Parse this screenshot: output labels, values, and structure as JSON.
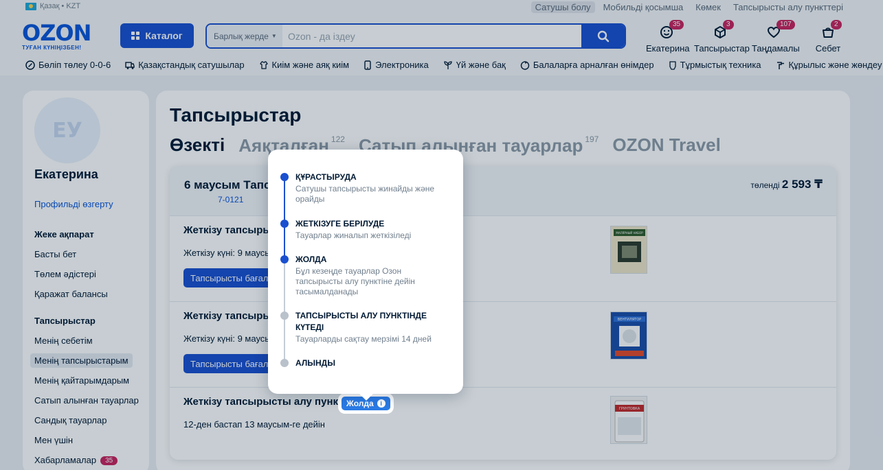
{
  "topbar": {
    "locale": "Қазақ • KZT",
    "links": [
      "Сатушы болу",
      "Мобильді қосымша",
      "Көмек",
      "Тапсырысты алу пункттері"
    ]
  },
  "header": {
    "logo_word": "OZON",
    "logo_sub": "ТУҒАН КҮНІҢІЗБЕН!",
    "catalog_label": "Каталог",
    "search_scope": "Барлық жерде",
    "search_placeholder": "Ozon - да іздеу",
    "items": [
      {
        "label": "Екатерина",
        "badge": "35",
        "icon": "smile-icon"
      },
      {
        "label": "Тапсырыстар",
        "badge": "3",
        "icon": "box-icon"
      },
      {
        "label": "Таңдамалы",
        "badge": "107",
        "icon": "heart-icon"
      },
      {
        "label": "Себет",
        "badge": "2",
        "icon": "cart-icon"
      }
    ]
  },
  "nav": [
    {
      "label": "Бөліп төлеу 0-0-6",
      "icon": "percent-icon"
    },
    {
      "label": "Қазақстандық сатушылар",
      "icon": "truck-icon"
    },
    {
      "label": "Киім және аяқ киім",
      "icon": "shirt-icon"
    },
    {
      "label": "Электроника",
      "icon": "phone-icon"
    },
    {
      "label": "Үй және бақ",
      "icon": "plant-icon"
    },
    {
      "label": "Балаларға арналған өнімдер",
      "icon": "baby-icon"
    },
    {
      "label": "Тұрмыстық техника",
      "icon": "appliance-icon"
    },
    {
      "label": "Құрылыс және жөндеу",
      "icon": "tools-icon"
    }
  ],
  "sidebar": {
    "avatar_initials": "ЕУ",
    "name": "Екатерина",
    "edit_profile": "Профильді өзгерту",
    "section_personal": "Жеке ақпарат",
    "personal_links": [
      "Басты бет",
      "Төлем әдістері",
      "Қаражат балансы"
    ],
    "section_orders": "Тапсырыстар",
    "order_links": [
      "Менің себетім",
      "Менің тапсырыстарым",
      "Менің қайтарымдарым",
      "Сатып алынған тауарлар",
      "Сандық тауарлар",
      "Мен үшін",
      "Хабарламалар"
    ],
    "notifications_badge": "35"
  },
  "main": {
    "title": "Тапсырыстар",
    "tabs": [
      {
        "label": "Өзекті",
        "count": ""
      },
      {
        "label": "Аяқталған",
        "count": "122"
      },
      {
        "label": "Сатып алынған тауарлар",
        "count": "197"
      },
      {
        "label": "OZON Travel",
        "count": ""
      }
    ],
    "order": {
      "date": "6 маусым Тапс",
      "number": "7-0121",
      "paid_label": "төленді",
      "paid_amount": "2 593 ₸",
      "shipments": [
        {
          "title": "Жеткізу тапсырыст",
          "date": "Жеткізу күні: 9 маусым",
          "button": "Тапсырысты бағалау"
        },
        {
          "title": "Жеткізу тапсырыст",
          "date": "Жеткізу күні: 9 маусым",
          "button": "Тапсырысты бағалау"
        },
        {
          "title": "Жеткізу тапсырысты алу пунктіне",
          "date": "12-ден бастап 13 маусым-ге дейін",
          "status": "Жолда"
        }
      ]
    }
  },
  "tooltip": {
    "steps": [
      {
        "title": "ҚҰРАСТЫРУДА",
        "desc": "Сатушы тапсырысты жинайды және орайды",
        "done": true
      },
      {
        "title": "ЖЕТКІЗУГЕ БЕРІЛУДЕ",
        "desc": "Тауарлар жиналып жеткізіледі",
        "done": true
      },
      {
        "title": "ЖОЛДА",
        "desc": "Бұл кезеңде тауарлар Озон тапсырысты алу пунктіне дейін тасымалданады",
        "done": true
      },
      {
        "title": "ТАПСЫРЫСТЫ АЛУ ПУНКТІНДЕ КҮТЕДІ",
        "desc": "Тауарларды сақтау мерзімі 14 дней",
        "done": false
      },
      {
        "title": "АЛЫНДЫ",
        "desc": "",
        "done": false
      }
    ]
  },
  "products": [
    {
      "text": "МАЛЯРНЫЙ НАБОР"
    },
    {
      "text": "ВЕНТИЛЯТОР"
    },
    {
      "text": "ГРУНТОВКА"
    }
  ],
  "colors": {
    "brand": "#0a55d9",
    "button": "#1a50d0",
    "badge": "#c8245e",
    "status": "#2a7be6"
  }
}
